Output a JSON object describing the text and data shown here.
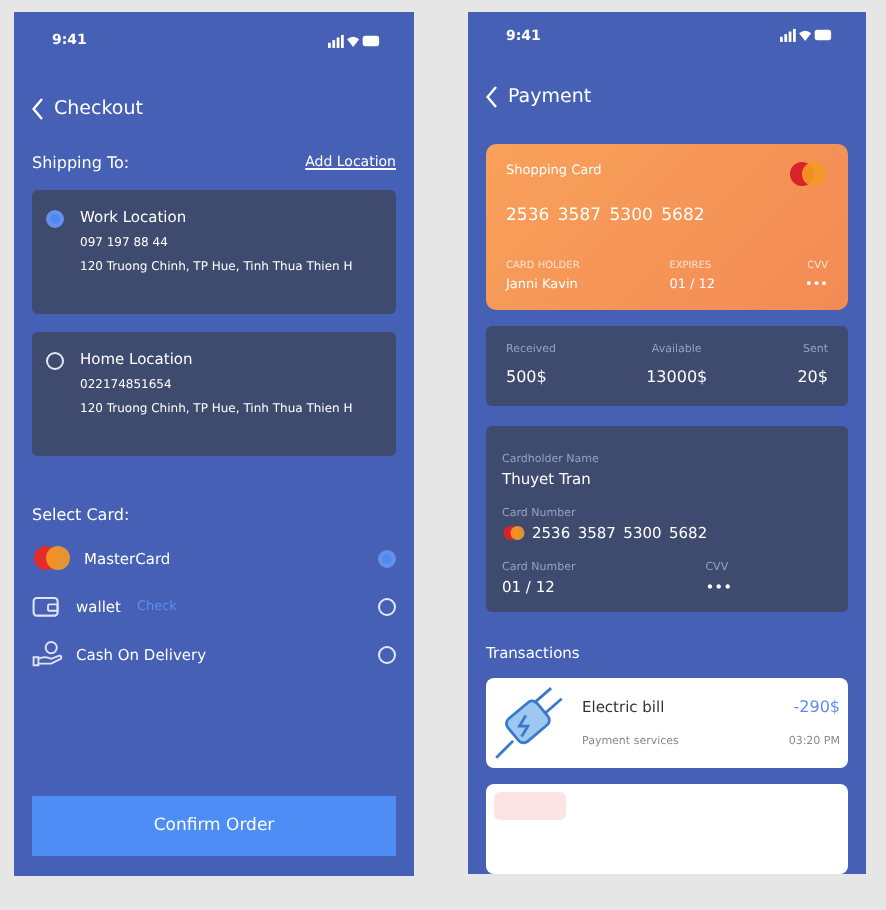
{
  "checkout": {
    "time": "9:41",
    "title": "Checkout",
    "shipping_label": "Shipping To:",
    "add_location": "Add Location",
    "locations": [
      {
        "name": "Work Location",
        "phone": "097 197 88 44",
        "address": "120 Truong Chinh, TP Hue, Tinh Thua Thien H",
        "selected": true
      },
      {
        "name": "Home Location",
        "phone": "022174851654",
        "address": "120 Truong Chinh, TP Hue, Tinh Thua Thien H",
        "selected": false
      }
    ],
    "select_card_label": "Select Card:",
    "payment_methods": [
      {
        "kind": "mastercard",
        "label": "MasterCard",
        "selected": true
      },
      {
        "kind": "wallet",
        "label": "wallet",
        "link": "Check",
        "selected": false
      },
      {
        "kind": "cash",
        "label": "Cash On Delivery",
        "selected": false
      }
    ],
    "confirm_button": "Confirm Order"
  },
  "payment": {
    "time": "9:41",
    "title": "Payment",
    "card": {
      "title": "Shopping Card",
      "number_groups": [
        "2536",
        "3587",
        "5300",
        "5682"
      ],
      "holder_label": "CARD HOLDER",
      "holder": "Janni Kavin",
      "expires_label": "EXPIRES",
      "expires": "01 / 12",
      "cvv_label": "CVV",
      "cvv": "•••"
    },
    "stats": [
      {
        "label": "Received",
        "value": "500$"
      },
      {
        "label": "Available",
        "value": "13000$"
      },
      {
        "label": "Sent",
        "value": "20$"
      }
    ],
    "details": {
      "name_label": "Cardholder Name",
      "name": "Thuyet Tran",
      "number_label": "Card Number",
      "number_groups": [
        "2536",
        "3587",
        "5300",
        "5682"
      ],
      "expiry_label": "Card Number",
      "expiry": "01 / 12",
      "cvv_label": "CVV",
      "cvv": "•••"
    },
    "transactions_title": "Transactions",
    "transactions": [
      {
        "title": "Electric bill",
        "subtitle": "Payment services",
        "amount": "-290$",
        "time": "03:20 PM"
      }
    ]
  }
}
